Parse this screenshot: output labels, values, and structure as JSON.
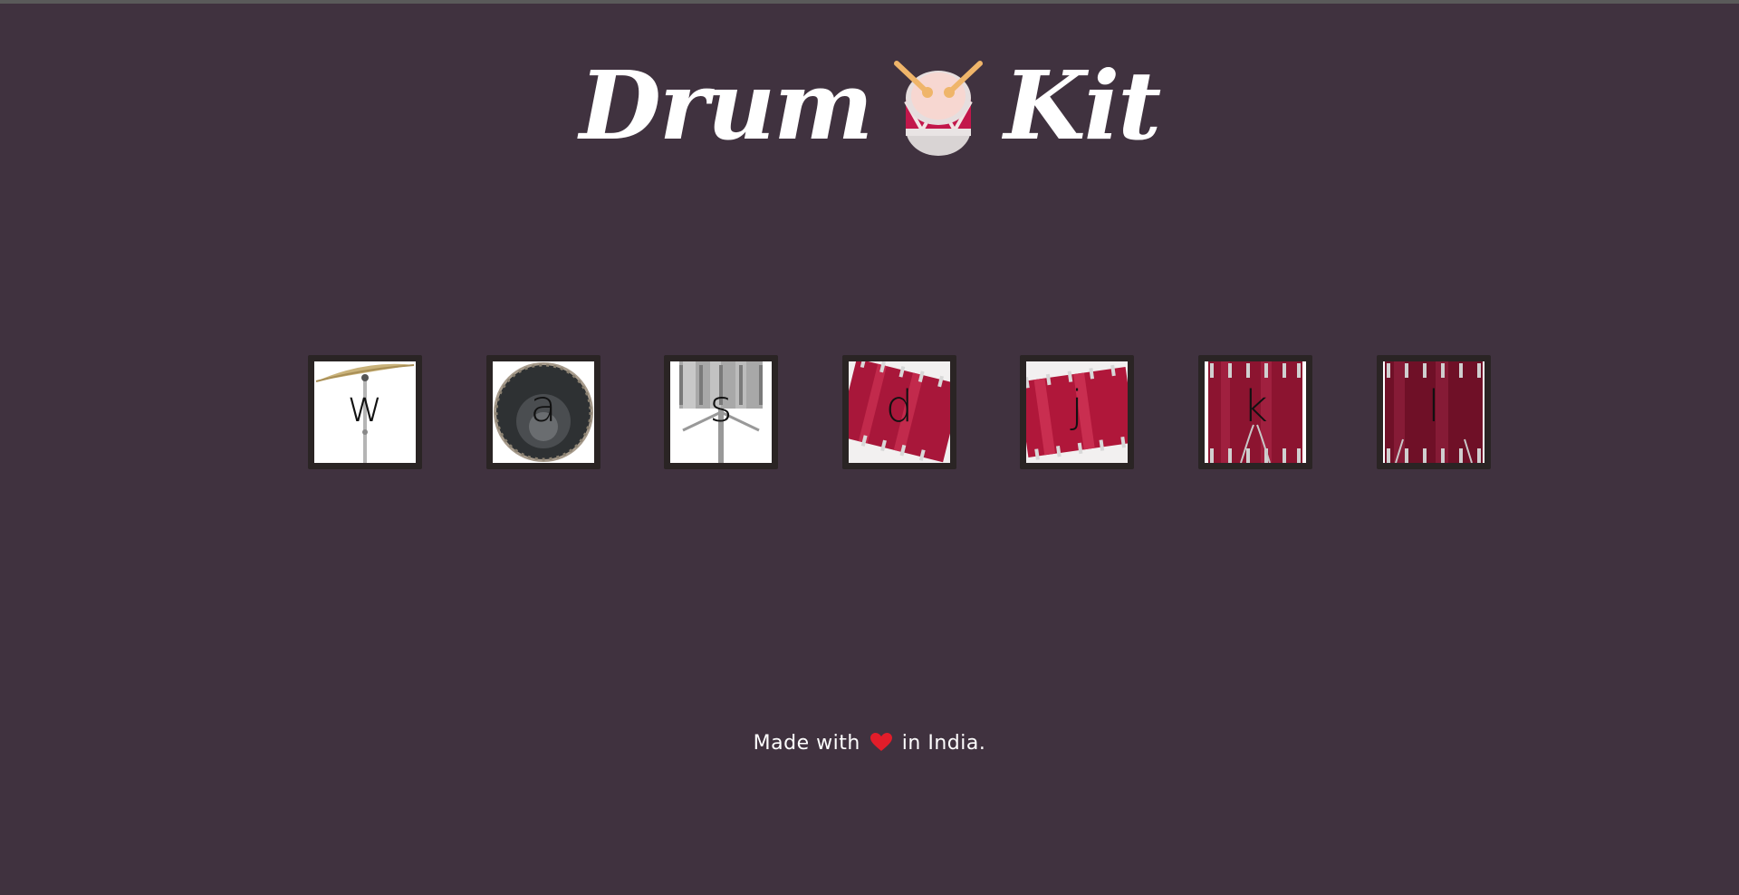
{
  "header": {
    "title_left": "Drum",
    "title_icon": "drum-emoji-icon",
    "title_right": "Kit"
  },
  "drums": [
    {
      "key": "w",
      "icon": "crash-cymbal-icon"
    },
    {
      "key": "a",
      "icon": "kick-drum-icon"
    },
    {
      "key": "s",
      "icon": "snare-drum-icon"
    },
    {
      "key": "d",
      "icon": "tom-1-icon"
    },
    {
      "key": "j",
      "icon": "tom-2-icon"
    },
    {
      "key": "k",
      "icon": "tom-3-icon"
    },
    {
      "key": "l",
      "icon": "tom-4-icon"
    }
  ],
  "footer": {
    "text_before": "Made with",
    "icon": "heart-icon",
    "text_after": "in India."
  },
  "colors": {
    "background": "#40323f",
    "drum_border": "#2a2424",
    "drum_red": "#b0173a",
    "title": "#ffffff"
  }
}
